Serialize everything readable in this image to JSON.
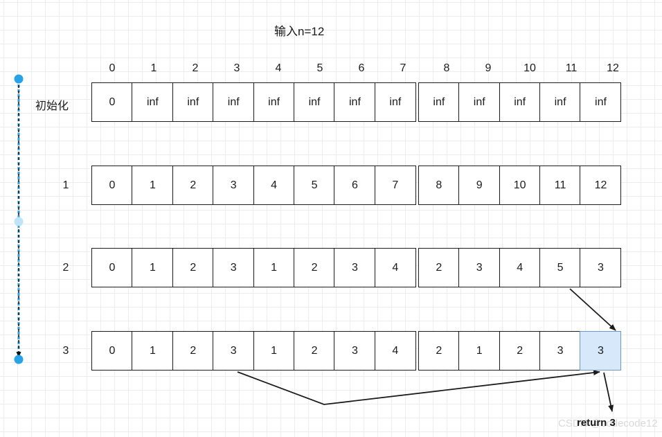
{
  "title": "输入n=12",
  "columns": [
    "0",
    "1",
    "2",
    "3",
    "4",
    "5",
    "6",
    "7",
    "8",
    "9",
    "10",
    "11",
    "12"
  ],
  "rows": [
    {
      "label": "初始化",
      "values": [
        "0",
        "inf",
        "inf",
        "inf",
        "inf",
        "inf",
        "inf",
        "inf",
        "inf",
        "inf",
        "inf",
        "inf",
        "inf"
      ]
    },
    {
      "label": "1",
      "values": [
        "0",
        "1",
        "2",
        "3",
        "4",
        "5",
        "6",
        "7",
        "8",
        "9",
        "10",
        "11",
        "12"
      ]
    },
    {
      "label": "2",
      "values": [
        "0",
        "1",
        "2",
        "3",
        "1",
        "2",
        "3",
        "4",
        "2",
        "3",
        "4",
        "5",
        "3"
      ]
    },
    {
      "label": "3",
      "values": [
        "0",
        "1",
        "2",
        "3",
        "1",
        "2",
        "3",
        "4",
        "2",
        "1",
        "2",
        "3",
        "3"
      ]
    }
  ],
  "annotations": {
    "return_label": "return 3",
    "watermark": "CSDN @codecode12"
  },
  "colors": {
    "highlight_fill": "#d8e8fb",
    "highlight_border": "#6b97c9",
    "line": "#1b1b1b",
    "selection_handle": "#29a3e8",
    "grid_minor": "#ededed",
    "grid_major": "#dedede"
  }
}
